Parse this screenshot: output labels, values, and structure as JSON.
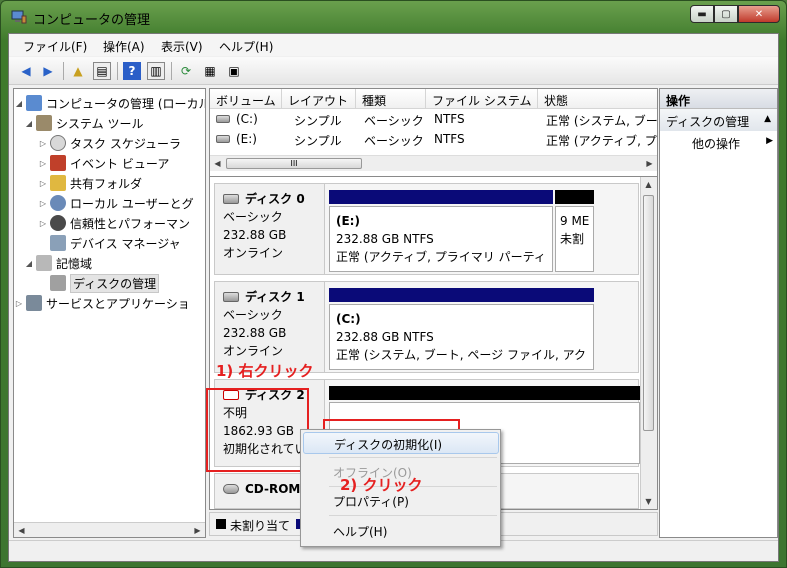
{
  "window": {
    "title": "コンピュータの管理",
    "min": "▬",
    "max": "▢",
    "close": "✕"
  },
  "menubar": [
    "ファイル(F)",
    "操作(A)",
    "表示(V)",
    "ヘルプ(H)"
  ],
  "tree": {
    "root": "コンピュータの管理 (ローカル",
    "system_tools": "システム ツール",
    "task_scheduler": "タスク スケジューラ",
    "event_viewer": "イベント ビューア",
    "shared_folders": "共有フォルダ",
    "local_users": "ローカル ユーザーとグ",
    "reliability": "信頼性とパフォーマン",
    "device_manager": "デバイス マネージャ",
    "storage": "記憶域",
    "disk_management": "ディスクの管理",
    "services_apps": "サービスとアプリケーショ"
  },
  "volume_list": {
    "columns": [
      "ボリューム",
      "レイアウト",
      "種類",
      "ファイル システム",
      "状態"
    ],
    "rows": [
      [
        "(C:)",
        "シンプル",
        "ベーシック",
        "NTFS",
        "正常 (システム, ブー"
      ],
      [
        "(E:)",
        "シンプル",
        "ベーシック",
        "NTFS",
        "正常 (アクティブ, プ"
      ]
    ],
    "scroll_thumb": "III"
  },
  "disks": [
    {
      "name": "ディスク 0",
      "type": "ベーシック",
      "size": "232.88 GB",
      "status": "オンライン",
      "partitions": [
        {
          "name": "(E:)",
          "size": "232.88 GB NTFS",
          "status": "正常 (アクティブ, プライマリ パーティ"
        },
        {
          "name": "",
          "size": "9 ME",
          "status": "未割"
        }
      ]
    },
    {
      "name": "ディスク 1",
      "type": "ベーシック",
      "size": "232.88 GB",
      "status": "オンライン",
      "partitions": [
        {
          "name": "(C:)",
          "size": "232.88 GB NTFS",
          "status": "正常 (システム, ブート, ページ ファイル, アク"
        }
      ]
    },
    {
      "name": "ディスク 2",
      "type": "不明",
      "size": "1862.93 GB",
      "status": "初期化されてい"
    },
    {
      "name": "CD-ROM 0"
    }
  ],
  "legend": {
    "unallocated": "未割り当て"
  },
  "actions": {
    "header": "操作",
    "section": "ディスクの管理",
    "other": "他の操作"
  },
  "context_menu": {
    "init": "ディスクの初期化(I)",
    "offline": "オフライン(O)",
    "properties": "プロパティ(P)",
    "help": "ヘルプ(H)"
  },
  "annotations": {
    "step1": "1) 右クリック",
    "step2": "2) クリック"
  },
  "colors": {
    "primary_partition": "#0a0a78",
    "unallocated": "#000000",
    "annotation": "#e52020"
  }
}
